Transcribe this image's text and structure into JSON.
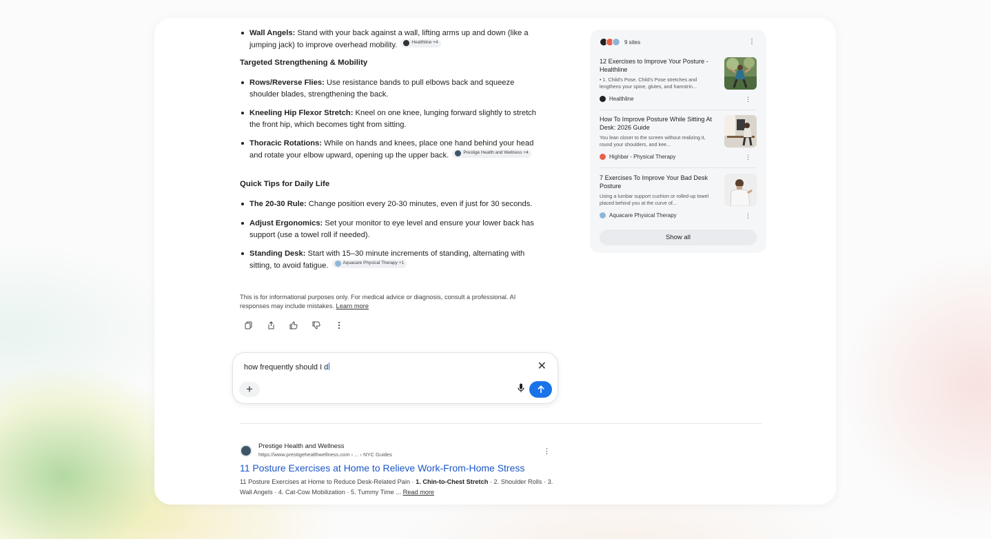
{
  "answer": {
    "wall_angels": {
      "label": "Wall Angels:",
      "text": " Stand with your back against a wall, lifting arms up and down (like a jumping jack) to improve overhead mobility.",
      "chip": "Healthline +4"
    },
    "heading_strength": "Targeted Strengthening & Mobility",
    "rows": {
      "label": "Rows/Reverse Flies:",
      "text": " Use resistance bands to pull elbows back and squeeze shoulder blades, strengthening the back."
    },
    "kneeling": {
      "label": "Kneeling Hip Flexor Stretch:",
      "text": "  Kneel on one knee, lunging forward slightly to stretch the front hip, which becomes tight from sitting."
    },
    "thoracic": {
      "label": "Thoracic Rotations:",
      "text": " While on hands and knees, place one hand behind your head and rotate your elbow upward, opening up the upper back.",
      "chip": "Prestige Health and Wellness +4"
    },
    "heading_tips": "Quick Tips for Daily Life",
    "rule": {
      "label": "The 20-30 Rule:",
      "text": " Change position every 20-30 minutes, even if just for 30 seconds."
    },
    "ergonomics": {
      "label": "Adjust Ergonomics:",
      "text": " Set your monitor to eye level and ensure your lower back has support (use a towel roll if needed)."
    },
    "standing": {
      "label": "Standing Desk:",
      "text": " Start with 15–30 minute increments of standing, alternating with sitting, to avoid fatigue.",
      "chip": "Aquacare Physical Therapy +1"
    },
    "disclaimer": "This is for informational purposes only. For medical advice or diagnosis, consult a professional. AI responses may include mistakes.",
    "learn_more": "Learn more"
  },
  "composer": {
    "query": "how frequently should I d"
  },
  "result": {
    "site": "Prestige Health and Wellness",
    "url": "https://www.prestigehealthwellness.com › ... › NYC Guides",
    "title": "11 Posture Exercises at Home to Relieve Work-From-Home Stress",
    "snippet_a": "11 Posture Exercises at Home to Reduce Desk-Related Pain · ",
    "snippet_bold": "1. Chin-to-Chest Stretch",
    "snippet_b": " · 2. Shoulder Rolls · 3. Wall Angels · 4. Cat-Cow Mobilization · 5. Tummy Time ... ",
    "read_more": "Read more"
  },
  "sources": {
    "count": "9 sites",
    "items": [
      {
        "title": "12 Exercises to Improve Your Posture - Healthline",
        "desc": "• 1. Child's Pose. Child's Pose stretches and lengthens your spine, glutes, and hamstrin...",
        "source": "Healthline"
      },
      {
        "title": "How To Improve Posture While Sitting At Desk: 2026 Guide",
        "desc": "You lean closer to the screen without realizing it, round your shoulders, and kee...",
        "source": "Highbar - Physical Therapy"
      },
      {
        "title": "7 Exercises To Improve Your Bad Desk Posture",
        "desc": "Using a lumbar support cushion or rolled-up towel placed behind you at the curve of...",
        "source": "Aquacare Physical Therapy"
      }
    ],
    "show_all": "Show all"
  },
  "colors": {
    "accent": "#1a73e8",
    "link": "#1a56c9"
  }
}
